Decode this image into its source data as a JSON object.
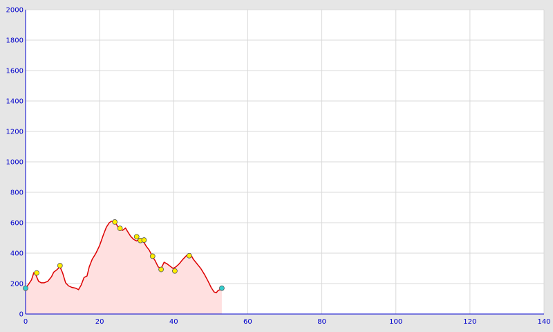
{
  "chart_data": {
    "type": "area",
    "title": "",
    "xlabel": "",
    "ylabel": "",
    "xlim": [
      0,
      140
    ],
    "ylim": [
      0,
      2000
    ],
    "x_ticks": [
      0,
      20,
      40,
      60,
      80,
      100,
      120,
      140
    ],
    "y_ticks": [
      0,
      200,
      400,
      600,
      800,
      1000,
      1200,
      1400,
      1600,
      1800,
      2000
    ],
    "grid": true,
    "legend": "none",
    "colors": {
      "line": "#dd0000",
      "fill": "#ffe0e0",
      "plot_background": "#ffffff",
      "page_background": "#e6e6e6",
      "grid": "#d8d8d8",
      "axis": "#0000cc",
      "marker_waypoint": "#ffee00",
      "marker_endpoint": "#33cccc",
      "marker_edge": "#555555"
    },
    "series": [
      {
        "x": [
          0,
          0.8,
          1.6,
          2.2,
          2.8,
          3.5,
          4.2,
          5,
          6,
          7,
          7.6,
          8.4,
          9.3,
          10,
          10.8,
          11.6,
          12.5,
          13.5,
          14.3,
          15,
          15.8,
          16.6,
          17.2,
          18,
          19,
          20,
          21,
          21.8,
          22.6,
          23.2,
          23.9,
          24.5,
          25.3,
          26.2,
          27,
          27.6,
          28.4,
          29.2,
          30,
          30.8,
          31.4,
          32,
          32.6,
          33.4,
          34.2,
          35,
          35.8,
          36.6,
          37.4,
          38.2,
          39,
          39.8,
          40.6,
          41.5,
          42.5,
          43.5,
          44.5,
          45.3,
          46.3,
          47.3,
          48.3,
          49.3,
          50.1,
          50.9,
          51.5,
          52,
          52.5,
          53
        ],
        "y": [
          170,
          195,
          225,
          270,
          255,
          215,
          205,
          205,
          215,
          245,
          275,
          290,
          310,
          270,
          205,
          185,
          175,
          170,
          160,
          190,
          240,
          250,
          310,
          360,
          400,
          450,
          520,
          570,
          600,
          610,
          605,
          590,
          560,
          550,
          565,
          540,
          510,
          490,
          480,
          495,
          480,
          470,
          445,
          420,
          380,
          350,
          310,
          300,
          340,
          330,
          315,
          300,
          310,
          330,
          360,
          385,
          395,
          360,
          330,
          300,
          260,
          215,
          175,
          145,
          140,
          155,
          160,
          165
        ]
      }
    ],
    "markers": [
      {
        "x": 0,
        "y": 170,
        "kind": "endpoint"
      },
      {
        "x": 3.0,
        "y": 270,
        "kind": "waypoint"
      },
      {
        "x": 9.3,
        "y": 318,
        "kind": "waypoint"
      },
      {
        "x": 24.1,
        "y": 605,
        "kind": "waypoint"
      },
      {
        "x": 25.5,
        "y": 563,
        "kind": "waypoint"
      },
      {
        "x": 30.0,
        "y": 508,
        "kind": "waypoint"
      },
      {
        "x": 31.0,
        "y": 483,
        "kind": "waypoint"
      },
      {
        "x": 32.0,
        "y": 486,
        "kind": "waypoint"
      },
      {
        "x": 34.3,
        "y": 380,
        "kind": "waypoint"
      },
      {
        "x": 36.6,
        "y": 293,
        "kind": "waypoint"
      },
      {
        "x": 40.3,
        "y": 283,
        "kind": "waypoint"
      },
      {
        "x": 44.2,
        "y": 383,
        "kind": "waypoint"
      },
      {
        "x": 53,
        "y": 170,
        "kind": "endpoint"
      }
    ]
  }
}
